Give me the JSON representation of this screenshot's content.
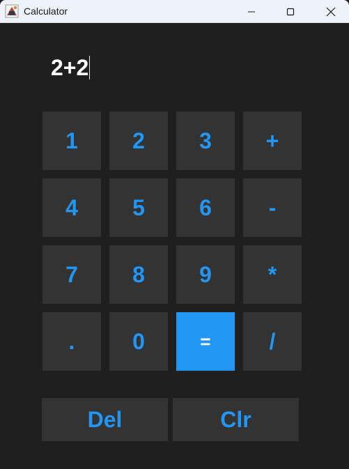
{
  "window": {
    "title": "Calculator",
    "controls": [
      "minimize",
      "maximize",
      "close"
    ]
  },
  "display": {
    "expression": "2+2"
  },
  "keypad": {
    "rows": [
      [
        "1",
        "2",
        "3",
        "+"
      ],
      [
        "4",
        "5",
        "6",
        "-"
      ],
      [
        "7",
        "8",
        "9",
        "*"
      ],
      [
        ".",
        "0",
        "=",
        "/"
      ]
    ]
  },
  "actions": {
    "delete_label": "Del",
    "clear_label": "Clr"
  },
  "colors": {
    "accent": "#2196f3",
    "key_background": "#333333",
    "window_background": "#1f1f1f",
    "titlebar_background": "#eef2f9"
  }
}
